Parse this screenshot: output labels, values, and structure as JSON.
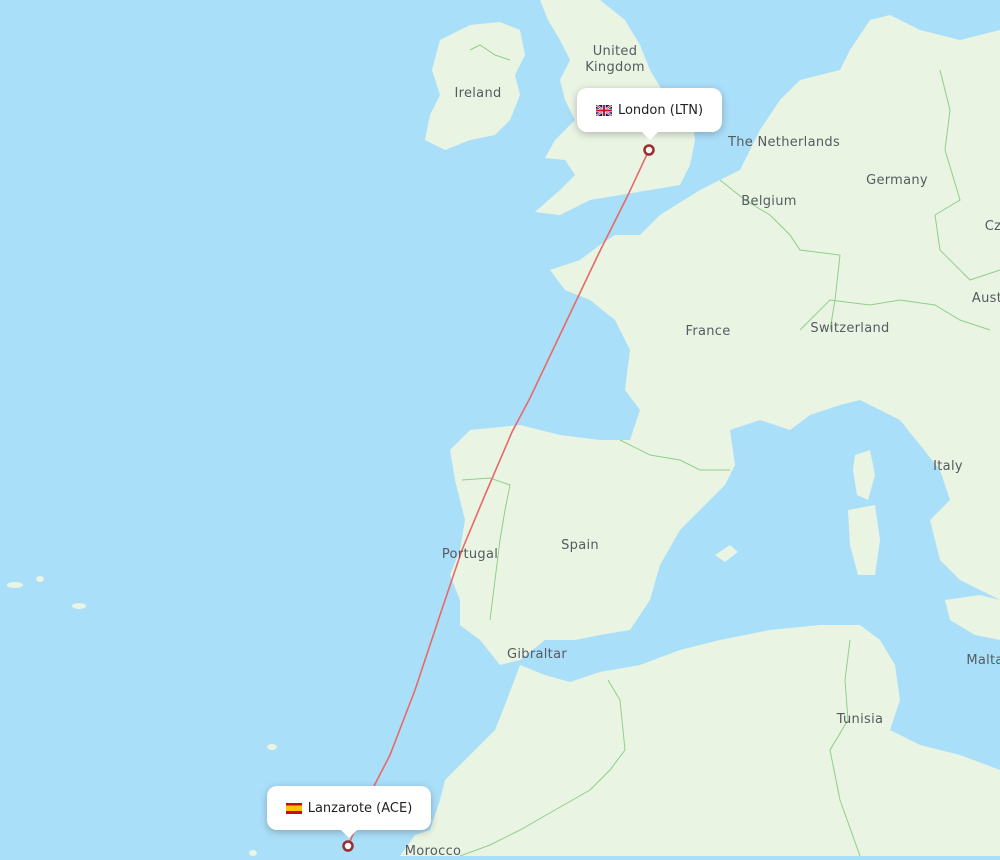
{
  "map": {
    "route": {
      "origin": {
        "name": "London",
        "code": "LTN",
        "label": "London (LTN)",
        "country_flag": "gb-flag-icon"
      },
      "destination": {
        "name": "Lanzarote",
        "code": "ACE",
        "label": "Lanzarote (ACE)",
        "country_flag": "es-flag-icon"
      },
      "line_color": "#e8696a",
      "marker_color": "#9b2c2c"
    },
    "colors": {
      "water": "#aadff9",
      "land": "#eaf4e3",
      "border": "#8fcf8a",
      "label": "#555b5f"
    },
    "labels": {
      "united_kingdom": "United\nKingdom",
      "united": "United",
      "kingdom": "Kingdom",
      "ireland": "Ireland",
      "netherlands": "The Netherlands",
      "belgium": "Belgium",
      "germany": "Germany",
      "czech": "Cz",
      "austria": "Aust",
      "switzerland": "Switzerland",
      "france": "France",
      "italy": "Italy",
      "portugal": "Portugal",
      "spain": "Spain",
      "gibraltar": "Gibraltar",
      "malta": "Malta",
      "tunisia": "Tunisia",
      "morocco": "Morocco"
    }
  }
}
